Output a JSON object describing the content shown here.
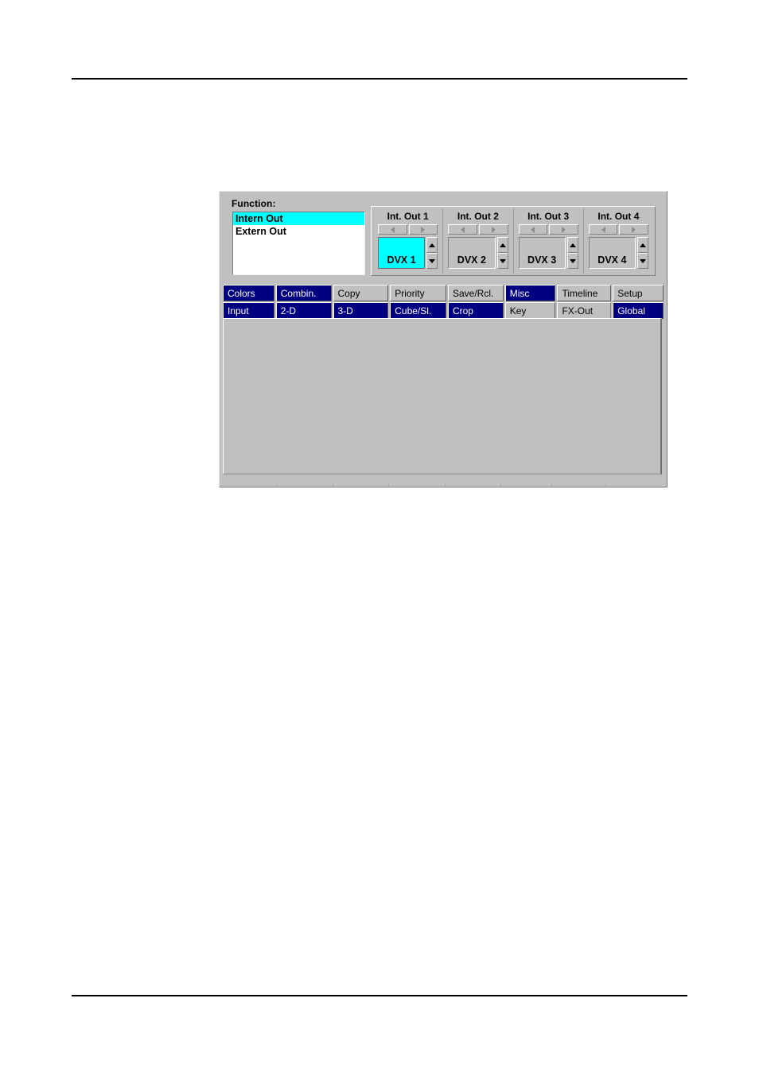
{
  "document": {
    "header_rule": true,
    "footer_rule": true
  },
  "panel": {
    "function_label": "Function:",
    "function_list": [
      {
        "label": "Intern Out",
        "selected": true
      },
      {
        "label": "Extern Out",
        "selected": false
      }
    ],
    "internal_outputs": [
      {
        "title": "Int. Out 1",
        "value": "DVX 1",
        "active": true,
        "prev_icon": "triangle-left-icon",
        "next_icon": "triangle-right-icon",
        "up_icon": "triangle-up-icon",
        "down_icon": "triangle-down-icon"
      },
      {
        "title": "Int. Out 2",
        "value": "DVX 2",
        "active": false,
        "prev_icon": "triangle-left-icon",
        "next_icon": "triangle-right-icon",
        "up_icon": "triangle-up-icon",
        "down_icon": "triangle-down-icon"
      },
      {
        "title": "Int. Out 3",
        "value": "DVX 3",
        "active": false,
        "prev_icon": "triangle-left-icon",
        "next_icon": "triangle-right-icon",
        "up_icon": "triangle-up-icon",
        "down_icon": "triangle-down-icon"
      },
      {
        "title": "Int. Out 4",
        "value": "DVX 4",
        "active": false,
        "prev_icon": "triangle-left-icon",
        "next_icon": "triangle-right-icon",
        "up_icon": "triangle-up-icon",
        "down_icon": "triangle-down-icon"
      }
    ],
    "tabs_row1": [
      {
        "label": "Colors",
        "state": "nav"
      },
      {
        "label": "Combin.",
        "state": "nav"
      },
      {
        "label": "Copy",
        "state": "idle"
      },
      {
        "label": "Priority",
        "state": "idle"
      },
      {
        "label": "Save/Rcl.",
        "state": "idle"
      },
      {
        "label": "Misc",
        "state": "nav"
      },
      {
        "label": "Timeline",
        "state": "idle"
      },
      {
        "label": "Setup",
        "state": "idle"
      }
    ],
    "tabs_row2": [
      {
        "label": "Input",
        "state": "nav"
      },
      {
        "label": "2-D",
        "state": "nav"
      },
      {
        "label": "3-D",
        "state": "nav"
      },
      {
        "label": "Cube/Sl.",
        "state": "nav"
      },
      {
        "label": "Crop",
        "state": "nav"
      },
      {
        "label": "Key",
        "state": "idle"
      },
      {
        "label": "FX-Out",
        "state": "active"
      },
      {
        "label": "Global",
        "state": "nav"
      }
    ],
    "content_pane": {
      "selected_tab": "FX-Out",
      "body_text": ""
    }
  },
  "colors": {
    "window_face": "#c0c0c0",
    "nav_tab": "#000080",
    "nav_tab_text": "#ffffff",
    "selection_cyan": "#00ffff",
    "list_background": "#ffffff",
    "text": "#000000",
    "shadow": "#808080",
    "highlight": "#ffffff"
  }
}
